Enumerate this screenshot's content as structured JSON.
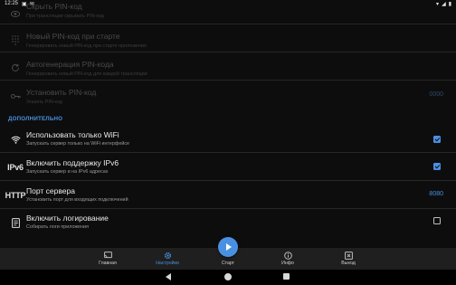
{
  "status_bar": {
    "time": "12:25",
    "left_icons": [
      "screen-share-icon",
      "notification-icon"
    ],
    "right_icons": [
      "wifi-icon",
      "signal-icon",
      "battery-icon"
    ]
  },
  "rows_top": [
    {
      "icon": "eye-icon",
      "glyph": "👁",
      "title": "Скрыть PIN-код",
      "subtitle": "При трансляции скрывать PIN-код",
      "control": "none"
    },
    {
      "icon": "dialpad-icon",
      "glyph": "⠿",
      "title": "Новый PIN-код при старте",
      "subtitle": "Генерировать новый PIN-код при старте приложения",
      "control": "none"
    },
    {
      "icon": "refresh-icon",
      "glyph": "⟳",
      "title": "Автогенерация PIN-кода",
      "subtitle": "Генерировать новый PIN-код для каждой трансляции",
      "control": "none"
    },
    {
      "icon": "key-icon",
      "glyph": "⚿",
      "title": "Установить PIN-код",
      "subtitle": "Указать PIN-код",
      "value": "0000"
    }
  ],
  "section_label": "ДОПОЛНИТЕЛЬНО",
  "rows_additional": [
    {
      "icon": "wifi-icon",
      "glyph": "",
      "title": "Использовать только WiFi",
      "subtitle": "Запускать сервер только на WiFi интерфейсе",
      "checked": true
    },
    {
      "icon": "ipv6-icon",
      "tag": "IPv6",
      "title": "Включить поддержку IPv6",
      "subtitle": "Запускать сервер и на IPv6 адресах",
      "checked": true
    },
    {
      "icon": "http-icon",
      "tag": "HTTP",
      "title": "Порт сервера",
      "subtitle": "Установить порт для входящих подключений",
      "value": "8080"
    },
    {
      "icon": "log-file-icon",
      "glyph": "▤",
      "title": "Включить логирование",
      "subtitle": "Собирать логи приложения",
      "checked": false
    }
  ],
  "bottom_nav": [
    {
      "id": "main",
      "label": "Главная",
      "icon": "cast-icon",
      "glyph": "▣",
      "active": false
    },
    {
      "id": "settings",
      "label": "Настройки",
      "icon": "gear-icon",
      "glyph": "⚙",
      "active": true
    },
    {
      "id": "start",
      "label": "Старт",
      "icon": "play-icon",
      "active": false
    },
    {
      "id": "info",
      "label": "Инфо",
      "icon": "info-icon",
      "glyph": "ⓘ",
      "active": false
    },
    {
      "id": "exit",
      "label": "Выход",
      "icon": "close-icon",
      "glyph": "✕",
      "active": false
    }
  ],
  "colors": {
    "accent": "#4a90e2",
    "background": "#0d0d0d",
    "bottom_nav": "#1f1f1f"
  }
}
